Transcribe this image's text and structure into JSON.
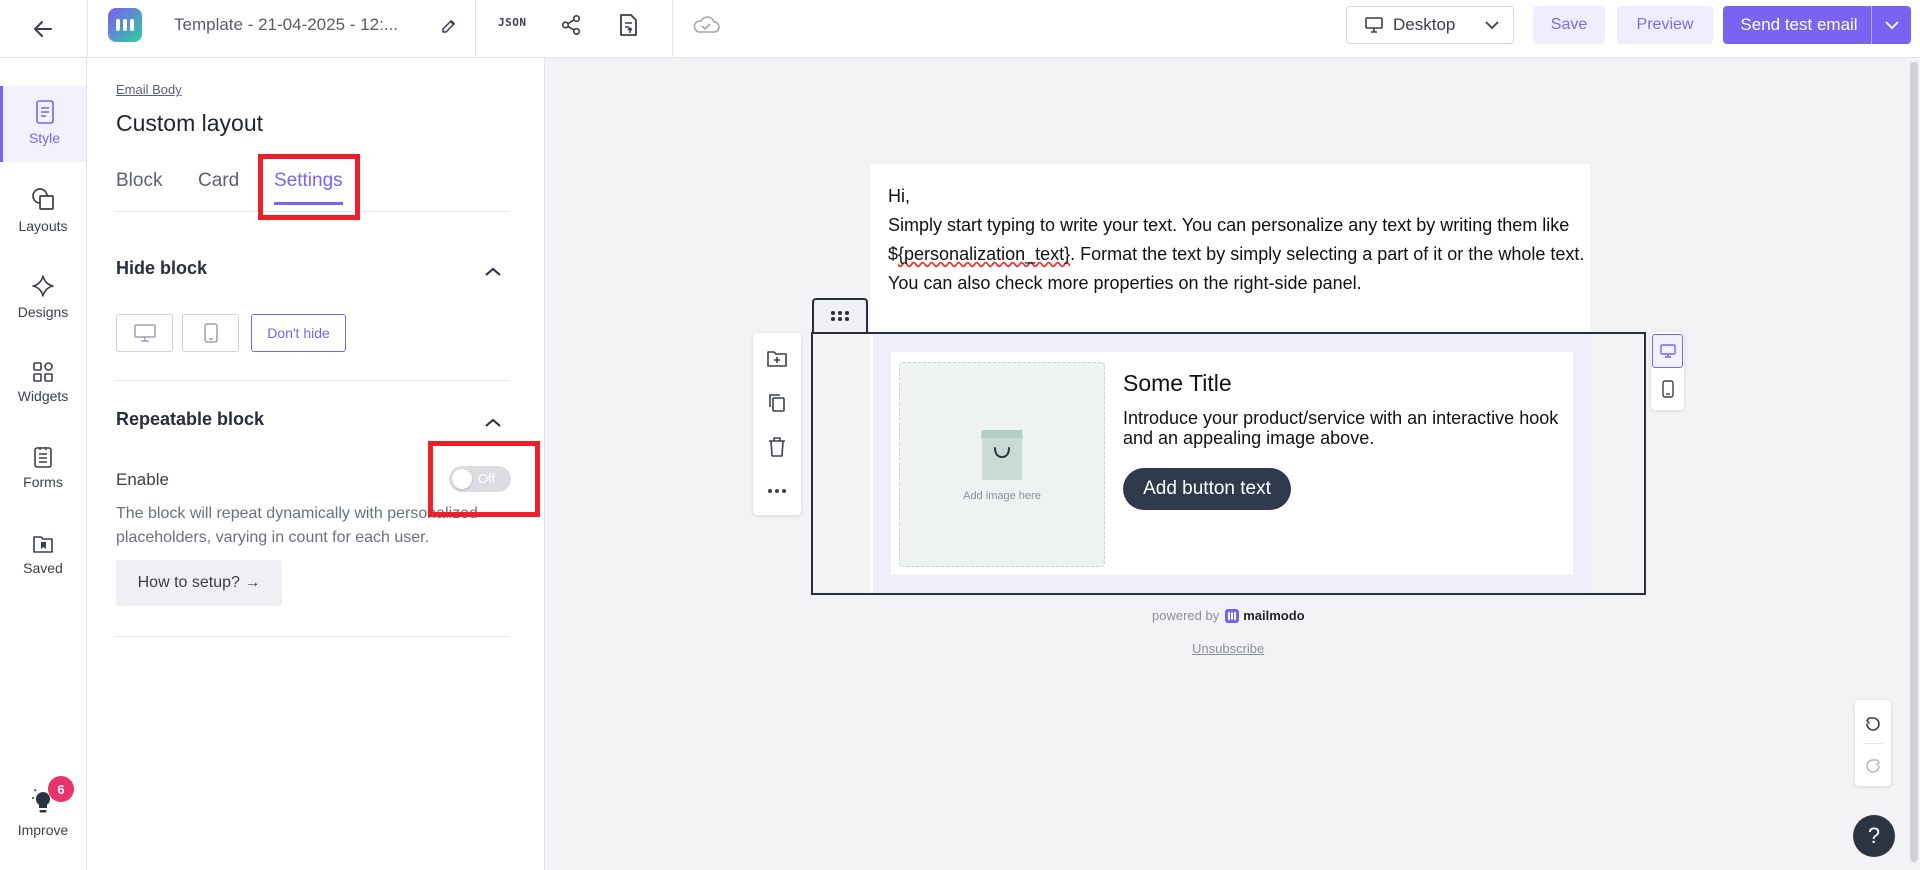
{
  "header": {
    "template_name": "Template - 21-04-2025 - 12:...",
    "json_label": "JSON",
    "device": "Desktop",
    "save_label": "Save",
    "preview_label": "Preview",
    "send_label": "Send test email"
  },
  "rail": {
    "items": [
      {
        "label": "Style",
        "icon": "style-icon",
        "active": true
      },
      {
        "label": "Layouts",
        "icon": "layouts-icon"
      },
      {
        "label": "Designs",
        "icon": "sparkle-icon"
      },
      {
        "label": "Widgets",
        "icon": "widgets-icon"
      },
      {
        "label": "Forms",
        "icon": "forms-icon"
      },
      {
        "label": "Saved",
        "icon": "saved-folder-icon"
      }
    ],
    "improve": {
      "label": "Improve",
      "badge": "6"
    }
  },
  "panel": {
    "breadcrumb": "Email Body",
    "title": "Custom layout",
    "tabs": [
      {
        "label": "Block"
      },
      {
        "label": "Card"
      },
      {
        "label": "Settings",
        "active": true
      }
    ],
    "hide_block": {
      "title": "Hide block",
      "options": [
        "desktop",
        "mobile",
        "Don't hide"
      ],
      "selected": "Don't hide"
    },
    "repeatable": {
      "title": "Repeatable block",
      "enable_label": "Enable",
      "toggle_state": "Off",
      "description": "The block will repeat dynamically with personalized placeholders, varying in count for each user.",
      "how_to_label": "How to setup? →"
    }
  },
  "canvas": {
    "greeting": "Hi,",
    "paragraph_before": "Simply start typing to write your text. You can personalize any text by writing them like $",
    "paragraph_token": "{personalization_text}",
    "paragraph_after": ". Format the text by simply selecting a part of it or the whole text. You can also check more properties on the right-side panel.",
    "card": {
      "image_caption": "Add image here",
      "title": "Some Title",
      "body": "Introduce your product/service with an interactive hook and an appealing image above.",
      "button": "Add button text"
    },
    "powered_by": "powered by",
    "brand": "mailmodo",
    "unsubscribe": "Unsubscribe"
  },
  "colors": {
    "accent": "#7b63f2",
    "highlight_box": "#ee1f2b",
    "badge": "#e8336b",
    "card_button": "#2f3b4d"
  }
}
